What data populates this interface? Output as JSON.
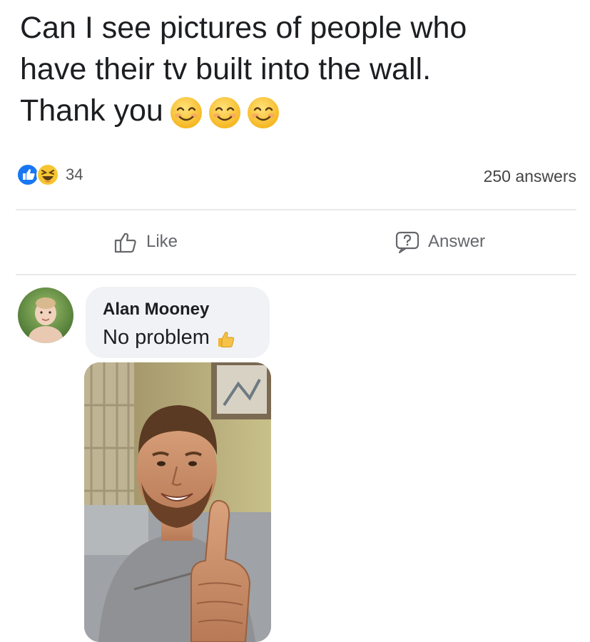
{
  "question": {
    "line1": "Can I see pictures of people who",
    "line2": "have their tv built into the wall.",
    "line3": "Thank you",
    "emojis": [
      "smiling-face-icon",
      "smiling-face-icon",
      "smiling-face-icon"
    ]
  },
  "stats": {
    "reaction_icons": [
      "like-reaction-icon",
      "haha-reaction-icon"
    ],
    "reaction_count": "34",
    "answers_count": "250 answers"
  },
  "actions": {
    "like_label": "Like",
    "answer_label": "Answer"
  },
  "comment": {
    "author": "Alan Mooney",
    "text": "No problem",
    "text_emoji": "thumbs-up-icon"
  },
  "colors": {
    "accent": "#1877f2",
    "muted_text": "#65676b",
    "bubble_bg": "#f0f2f5",
    "divider": "#e8e9eb"
  }
}
